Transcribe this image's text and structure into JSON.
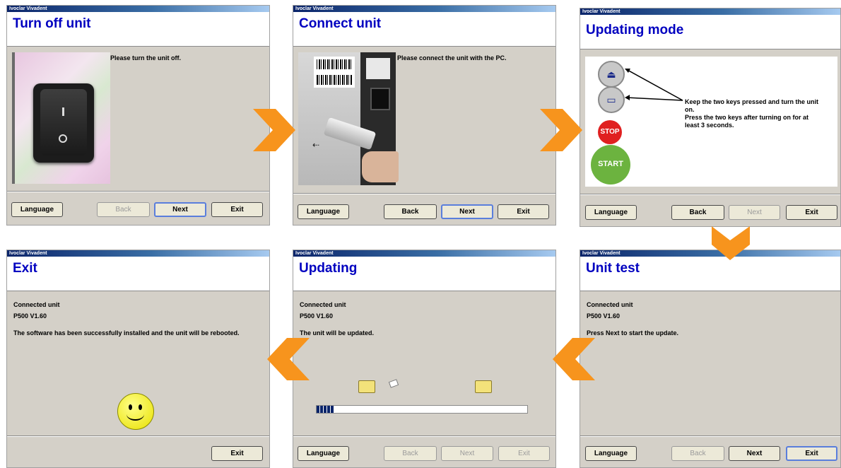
{
  "common": {
    "brand": "Ivoclar Vivadent",
    "language_label": "Language",
    "back_label": "Back",
    "next_label": "Next",
    "exit_label": "Exit"
  },
  "panel1": {
    "title": "Turn off unit",
    "text": "Please turn the unit off."
  },
  "panel2": {
    "title": "Connect unit",
    "text": "Please connect the unit with the PC."
  },
  "panel3": {
    "title": "Updating mode",
    "instruction_1": "Keep the two keys pressed and turn the unit on.",
    "instruction_2": "Press the two keys after turning on for at least 3 seconds.",
    "stop_label": "STOP",
    "start_label": "START"
  },
  "panel4": {
    "title": "Unit test",
    "connected_label": "Connected unit",
    "unit_version": "P500  V1.60",
    "message": "Press Next to start the update."
  },
  "panel5": {
    "title": "Updating",
    "connected_label": "Connected unit",
    "unit_version": "P500  V1.60",
    "message": "The unit will be updated.",
    "progress_fraction": 0.08
  },
  "panel6": {
    "title": "Exit",
    "connected_label": "Connected unit",
    "unit_version": "P500  V1.60",
    "message": "The software has been successfully installed and the unit will be rebooted."
  },
  "colors": {
    "arrow": "#f7941d",
    "title": "#0000c0",
    "stop": "#e02020",
    "start": "#6cb33f"
  },
  "icons": [
    "arrow-right-icon",
    "arrow-down-icon",
    "arrow-left-icon",
    "folder-icon",
    "flying-file-icon",
    "smiley-icon"
  ]
}
